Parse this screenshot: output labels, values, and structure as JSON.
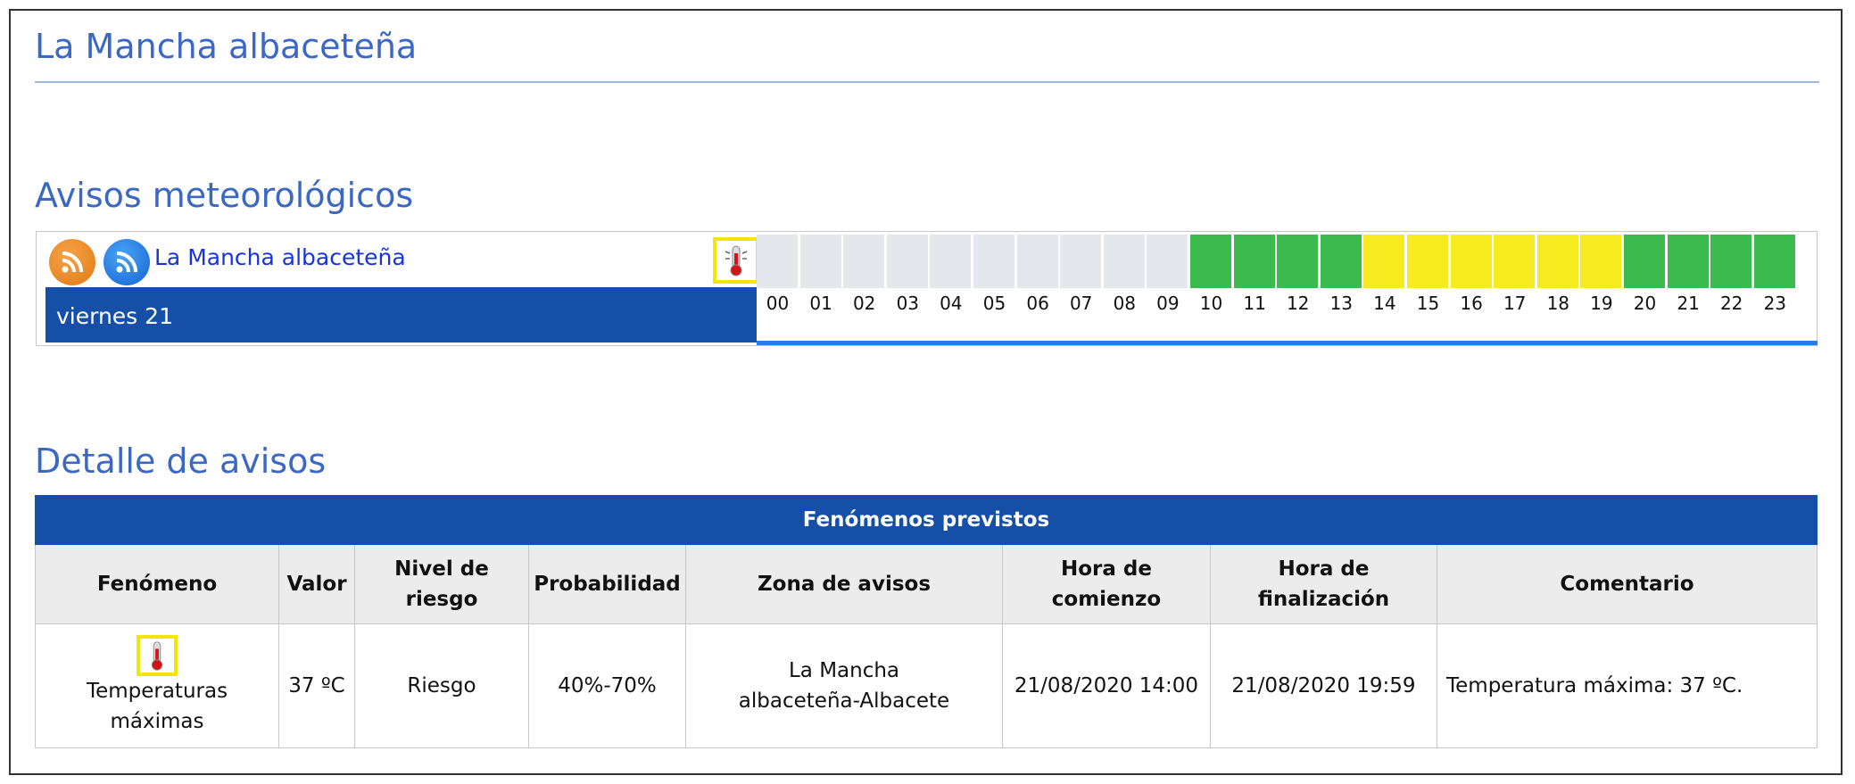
{
  "title": "La Mancha albaceteña",
  "avisos_heading": "Avisos meteorológicos",
  "detalle_heading": "Detalle de avisos",
  "avisos": {
    "zone_link": "La Mancha albaceteña",
    "day": "viernes 21",
    "hours": [
      "00",
      "01",
      "02",
      "03",
      "04",
      "05",
      "06",
      "07",
      "08",
      "09",
      "10",
      "11",
      "12",
      "13",
      "14",
      "15",
      "16",
      "17",
      "18",
      "19",
      "20",
      "21",
      "22",
      "23"
    ],
    "hour_levels": [
      "none",
      "none",
      "none",
      "none",
      "none",
      "none",
      "none",
      "none",
      "none",
      "none",
      "green",
      "green",
      "green",
      "green",
      "yellow",
      "yellow",
      "yellow",
      "yellow",
      "yellow",
      "yellow",
      "green",
      "green",
      "green",
      "green"
    ],
    "colors": {
      "none": "#e4e7ec",
      "green": "#3cba4e",
      "yellow": "#f5eb1e"
    },
    "icons": [
      "rss-orange-icon",
      "rss-blue-icon",
      "thermometer-icon"
    ]
  },
  "table": {
    "caption": "Fenómenos previstos",
    "headers": [
      "Fenómeno",
      "Valor",
      "Nivel de riesgo",
      "Probabilidad",
      "Zona de avisos",
      "Hora de comienzo",
      "Hora de finalización",
      "Comentario"
    ],
    "row": {
      "fenomeno": "Temperaturas máximas",
      "valor": "37 ºC",
      "nivel": "Riesgo",
      "probabilidad": "40%-70%",
      "zona": "La Mancha albaceteña-Albacete",
      "comienzo": "21/08/2020 14:00",
      "finalizacion": "21/08/2020 19:59",
      "comentario": "Temperatura máxima: 37 ºC."
    }
  }
}
